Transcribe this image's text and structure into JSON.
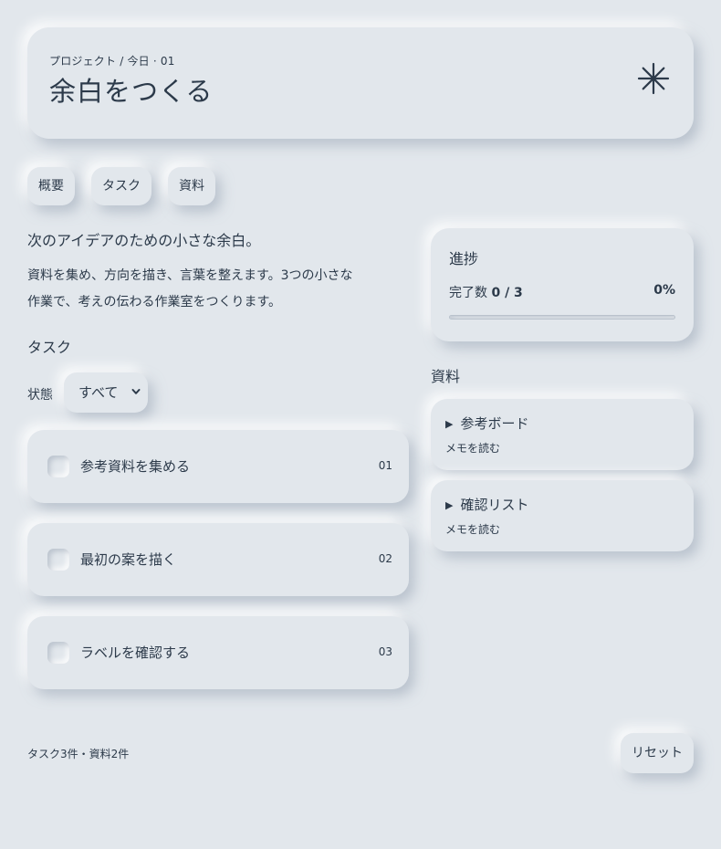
{
  "header": {
    "breadcrumb": "プロジェクト / 今日 · 01",
    "title": "余白をつくる",
    "icon": "sparkle-icon"
  },
  "tabs": [
    {
      "label": "概要"
    },
    {
      "label": "タスク"
    },
    {
      "label": "資料"
    }
  ],
  "intro": {
    "lead": "次のアイデアのための小さな余白。",
    "description_line1": "資料を集め、方向を描き、言葉を整えます。3つの小さな",
    "description_line2": "作業で、考えの伝わる作業室をつくります。"
  },
  "tasks_section": {
    "heading": "タスク",
    "filter_label": "状態",
    "filter_selected": "すべて",
    "items": [
      {
        "label": "参考資料を集める",
        "number": "01",
        "done": false
      },
      {
        "label": "最初の案を描く",
        "number": "02",
        "done": false
      },
      {
        "label": "ラベルを確認する",
        "number": "03",
        "done": false
      }
    ]
  },
  "progress": {
    "heading": "進捗",
    "completed_label": "完了数",
    "completed_value": "0 / 3",
    "percent": "0%",
    "fraction": 0
  },
  "resources": {
    "heading": "資料",
    "items": [
      {
        "title": "参考ボード",
        "subtitle": "メモを読む"
      },
      {
        "title": "確認リスト",
        "subtitle": "メモを読む"
      }
    ]
  },
  "footer": {
    "summary": "タスク3件・資料2件",
    "reset_label": "リセット"
  },
  "colors": {
    "background": "#e2e7ec",
    "text": "#2c3a4a"
  }
}
